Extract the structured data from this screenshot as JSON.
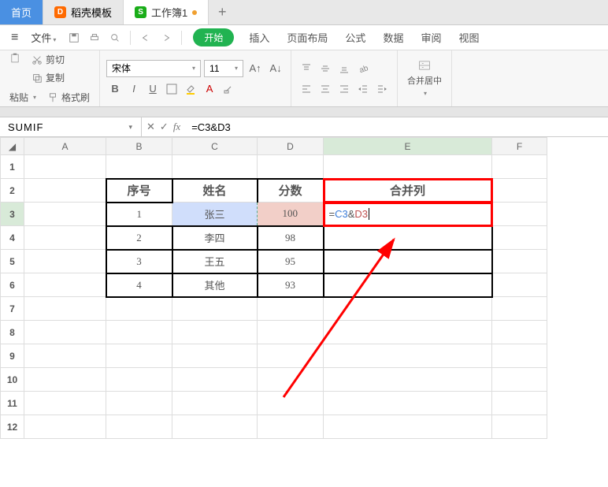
{
  "tabs": {
    "home": "首页",
    "template": "稻壳模板",
    "workbook": "工作簿1"
  },
  "menu": {
    "file": "文件"
  },
  "ribbon_tabs": {
    "start": "开始",
    "insert": "插入",
    "layout": "页面布局",
    "formula": "公式",
    "data": "数据",
    "review": "审阅",
    "view": "视图"
  },
  "clipboard": {
    "cut": "剪切",
    "copy": "复制",
    "paste": "粘贴",
    "format": "格式刷"
  },
  "font": {
    "name": "宋体",
    "size": "11"
  },
  "merge": "合并居中",
  "namebox": "SUMIF",
  "formula": "=C3&D3",
  "headers": {
    "B": "序号",
    "C": "姓名",
    "D": "分数",
    "E": "合并列"
  },
  "rows": [
    {
      "b": "1",
      "c": "张三",
      "d": "100"
    },
    {
      "b": "2",
      "c": "李四",
      "d": "98"
    },
    {
      "b": "3",
      "c": "王五",
      "d": "95"
    },
    {
      "b": "4",
      "c": "其他",
      "d": "93"
    }
  ],
  "edit": {
    "prefix": "=",
    "ref1": "C3",
    "amp": "&",
    "ref2": "D3"
  },
  "cols": [
    "A",
    "B",
    "C",
    "D",
    "E",
    "F"
  ],
  "chart_data": {
    "type": "table",
    "columns": [
      "序号",
      "姓名",
      "分数",
      "合并列"
    ],
    "data": [
      [
        "1",
        "张三",
        "100",
        "=C3&D3"
      ],
      [
        "2",
        "李四",
        "98",
        ""
      ],
      [
        "3",
        "王五",
        "95",
        ""
      ],
      [
        "4",
        "其他",
        "93",
        ""
      ]
    ]
  }
}
